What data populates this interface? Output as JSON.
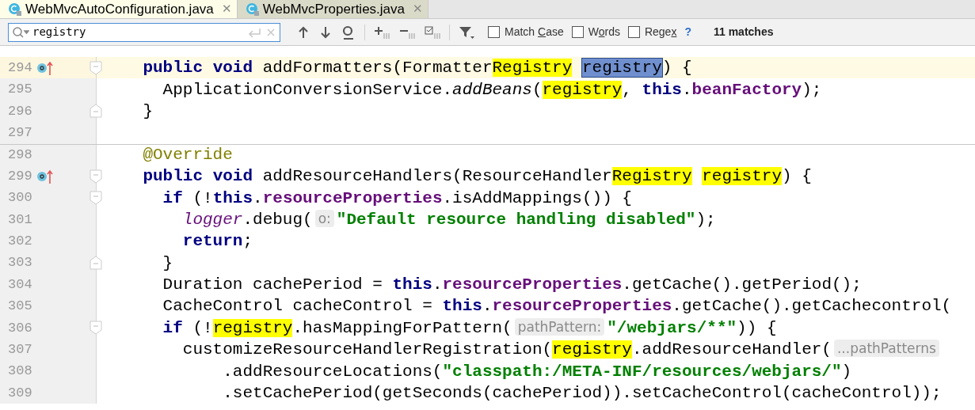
{
  "tabs": [
    {
      "label": "WebMvcAutoConfiguration.java",
      "close": "✕",
      "selected": true
    },
    {
      "label": "WebMvcProperties.java",
      "close": "✕",
      "selected": false
    }
  ],
  "search": {
    "value": "registry",
    "options": [
      {
        "label": [
          {
            "text": "Match ",
            "mnemonic": false
          },
          {
            "text": "C",
            "mnemonic": true
          },
          {
            "text": "ase",
            "mnemonic": false
          }
        ],
        "checked": false
      },
      {
        "label": [
          {
            "text": "W",
            "mnemonic": false
          },
          {
            "text": "o",
            "mnemonic": true
          },
          {
            "text": "rds",
            "mnemonic": false
          }
        ],
        "checked": false
      },
      {
        "label": [
          {
            "text": "Rege",
            "mnemonic": false
          },
          {
            "text": "x",
            "mnemonic": true
          }
        ],
        "checked": false
      }
    ],
    "help": "?",
    "matches": "11 matches"
  },
  "lines": [
    {
      "number": "294",
      "overrides": true,
      "fold_start": true,
      "fold_end": false,
      "current": true,
      "tokens": [
        {
          "kind": "keyword",
          "text": "    public "
        },
        {
          "kind": "keyword",
          "text": "void"
        },
        {
          "kind": "plain",
          "text": " addFormatters(Formatter"
        },
        {
          "kind": "match",
          "text": "Registry"
        },
        {
          "kind": "current_match",
          "text": " registry"
        },
        {
          "kind": "plain",
          "text": ") {"
        }
      ]
    },
    {
      "number": "295",
      "overrides": false,
      "fold_start": false,
      "fold_end": false,
      "current": false,
      "tokens": [
        {
          "kind": "plain",
          "text": "      ApplicationConversionService."
        },
        {
          "kind": "italic",
          "text": "addBeans"
        },
        {
          "kind": "plain",
          "text": "("
        },
        {
          "kind": "match",
          "text": "registry"
        },
        {
          "kind": "plain",
          "text": ", "
        },
        {
          "kind": "keyword",
          "text": "this"
        },
        {
          "kind": "plain",
          "text": "."
        },
        {
          "kind": "field",
          "text": "beanFactory"
        },
        {
          "kind": "plain",
          "text": ");"
        }
      ]
    },
    {
      "number": "296",
      "overrides": false,
      "fold_start": false,
      "fold_end": true,
      "current": false,
      "tokens": [
        {
          "kind": "plain",
          "text": "    }"
        }
      ]
    },
    {
      "number": "297",
      "overrides": false,
      "fold_start": false,
      "fold_end": false,
      "current": false
    },
    {
      "number": "298",
      "overrides": false,
      "fold_start": false,
      "fold_end": false,
      "current": false,
      "tokens": [
        {
          "kind": "annotation",
          "text": "    @Override"
        }
      ]
    },
    {
      "number": "299",
      "overrides": true,
      "fold_start": true,
      "fold_end": false,
      "current": false,
      "tokens": [
        {
          "kind": "keyword",
          "text": "    public "
        },
        {
          "kind": "keyword",
          "text": "void"
        },
        {
          "kind": "plain",
          "text": " addResourceHandlers(ResourceHandler"
        },
        {
          "kind": "match",
          "text": "Registry"
        },
        {
          "kind": "match",
          "text": " registry"
        },
        {
          "kind": "plain",
          "text": ") {"
        }
      ]
    },
    {
      "number": "300",
      "overrides": false,
      "fold_start": true,
      "fold_end": false,
      "current": false,
      "tokens": [
        {
          "kind": "keyword",
          "text": "      if"
        },
        {
          "kind": "plain",
          "text": " (!"
        },
        {
          "kind": "keyword",
          "text": "this"
        },
        {
          "kind": "plain",
          "text": "."
        },
        {
          "kind": "field",
          "text": "resourceProperties"
        },
        {
          "kind": "plain",
          "text": ".isAddMappings()) {"
        }
      ]
    },
    {
      "number": "301",
      "overrides": false,
      "fold_start": false,
      "fold_end": false,
      "current": false,
      "tokens": [
        {
          "kind": "static",
          "text": "        logger"
        },
        {
          "kind": "plain",
          "text": ".debug("
        },
        {
          "kind": "hint",
          "text": "o:"
        },
        {
          "kind": "string",
          "text": "\"Default resource handling disabled\""
        },
        {
          "kind": "plain",
          "text": ");"
        }
      ]
    },
    {
      "number": "302",
      "overrides": false,
      "fold_start": false,
      "fold_end": false,
      "current": false,
      "tokens": [
        {
          "kind": "keyword",
          "text": "        return"
        },
        {
          "kind": "plain",
          "text": ";"
        }
      ]
    },
    {
      "number": "303",
      "overrides": false,
      "fold_start": false,
      "fold_end": true,
      "current": false,
      "tokens": [
        {
          "kind": "plain",
          "text": "      }"
        }
      ]
    },
    {
      "number": "304",
      "overrides": false,
      "fold_start": false,
      "fold_end": false,
      "current": false,
      "tokens": [
        {
          "kind": "plain",
          "text": "      Duration cachePeriod = "
        },
        {
          "kind": "keyword",
          "text": "this"
        },
        {
          "kind": "plain",
          "text": "."
        },
        {
          "kind": "field",
          "text": "resourceProperties"
        },
        {
          "kind": "plain",
          "text": ".getCache().getPeriod();"
        }
      ]
    },
    {
      "number": "305",
      "overrides": false,
      "fold_start": false,
      "fold_end": false,
      "current": false,
      "tokens": [
        {
          "kind": "plain",
          "text": "      CacheControl cacheControl = "
        },
        {
          "kind": "keyword",
          "text": "this"
        },
        {
          "kind": "plain",
          "text": "."
        },
        {
          "kind": "field",
          "text": "resourceProperties"
        },
        {
          "kind": "plain",
          "text": ".getCache().getCachecontrol("
        }
      ]
    },
    {
      "number": "306",
      "overrides": false,
      "fold_start": true,
      "fold_end": false,
      "current": false,
      "tokens": [
        {
          "kind": "keyword",
          "text": "      if"
        },
        {
          "kind": "plain",
          "text": " (!"
        },
        {
          "kind": "match",
          "text": "registry"
        },
        {
          "kind": "plain",
          "text": ".hasMappingForPattern("
        },
        {
          "kind": "hint",
          "text": "pathPattern:"
        },
        {
          "kind": "string",
          "text": "\"/webjars/**\""
        },
        {
          "kind": "plain",
          "text": ")) {"
        }
      ]
    },
    {
      "number": "307",
      "overrides": false,
      "fold_start": false,
      "fold_end": false,
      "current": false,
      "tokens": [
        {
          "kind": "plain",
          "text": "        customizeResourceHandlerRegistration("
        },
        {
          "kind": "match",
          "text": "registry"
        },
        {
          "kind": "plain",
          "text": ".addResourceHandler("
        },
        {
          "kind": "hint",
          "text": "...pathPatterns"
        }
      ]
    },
    {
      "number": "308",
      "overrides": false,
      "fold_start": false,
      "fold_end": false,
      "current": false,
      "tokens": [
        {
          "kind": "plain",
          "text": "            .addResourceLocations("
        },
        {
          "kind": "string",
          "text": "\"classpath:/META-INF/resources/webjars/\""
        },
        {
          "kind": "plain",
          "text": ")"
        }
      ]
    },
    {
      "number": "309",
      "overrides": false,
      "fold_start": false,
      "fold_end": false,
      "current": false,
      "tokens": [
        {
          "kind": "plain",
          "text": "            .setCachePeriod(getSeconds(cachePeriod)).setCacheControl(cacheControl));"
        }
      ]
    }
  ]
}
